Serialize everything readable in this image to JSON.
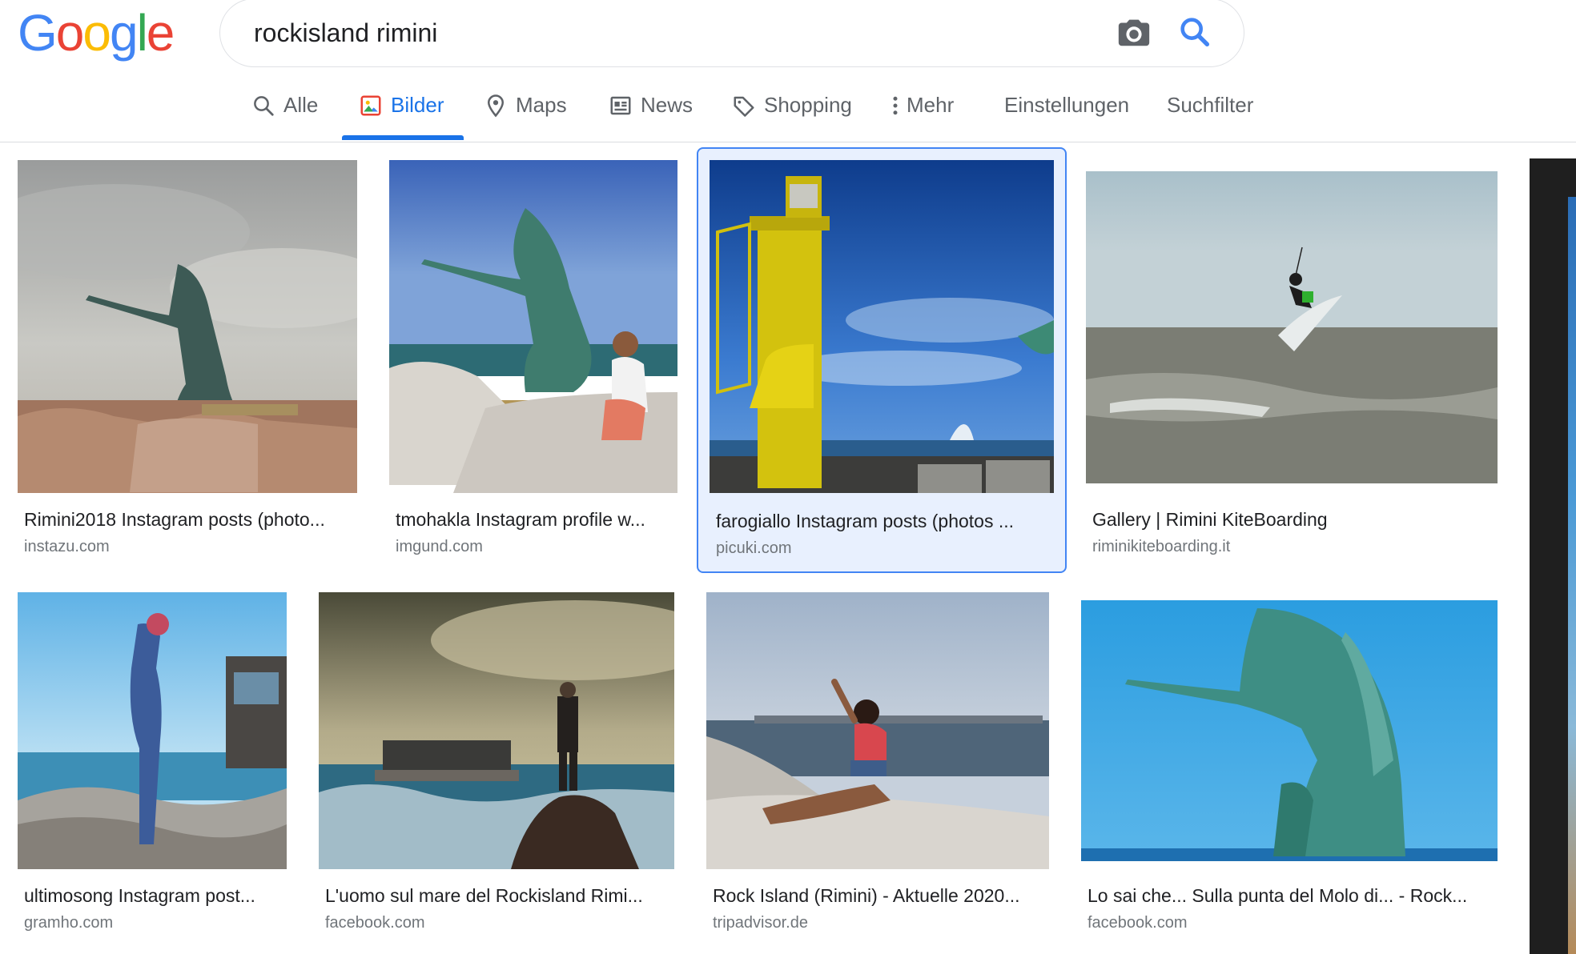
{
  "logo": {
    "letters": [
      "G",
      "o",
      "o",
      "g",
      "l",
      "e"
    ],
    "colors": [
      "#4285f4",
      "#ea4335",
      "#fbbc05",
      "#4285f4",
      "#34a853",
      "#ea4335"
    ]
  },
  "search": {
    "query": "rockisland rimini",
    "camera_icon": "camera-icon",
    "search_icon": "search-icon"
  },
  "tabs": [
    {
      "label": "Alle",
      "icon": "search-icon",
      "active": false
    },
    {
      "label": "Bilder",
      "icon": "image-icon",
      "active": true
    },
    {
      "label": "Maps",
      "icon": "map-pin-icon",
      "active": false
    },
    {
      "label": "News",
      "icon": "news-icon",
      "active": false
    },
    {
      "label": "Shopping",
      "icon": "tag-icon",
      "active": false
    },
    {
      "label": "Mehr",
      "icon": "more-vert-icon",
      "active": false
    },
    {
      "label": "Einstellungen",
      "icon": "",
      "active": false
    },
    {
      "label": "Suchfilter",
      "icon": "",
      "active": false
    }
  ],
  "accent_color": "#1a73e8",
  "results": [
    {
      "title": "Rimini2018 Instagram posts (photo...",
      "source": "instazu.com",
      "image": "statue-cloudy-sky",
      "selected": false
    },
    {
      "title": "tmohakla Instagram profile w...",
      "source": "imgund.com",
      "image": "statue-man-crouching",
      "selected": false
    },
    {
      "title": "farogiallo Instagram posts (photos ...",
      "source": "picuki.com",
      "image": "yellow-lighthouse",
      "selected": true
    },
    {
      "title": "Gallery | Rimini KiteBoarding",
      "source": "riminikiteboarding.it",
      "image": "kitesurfer-sea",
      "selected": false
    },
    {
      "title": "ultimosong Instagram post...",
      "source": "gramho.com",
      "image": "woman-on-rocks",
      "selected": false
    },
    {
      "title": "L'uomo sul mare del Rockisland Rimi...",
      "source": "facebook.com",
      "image": "man-on-rock-painting",
      "selected": false
    },
    {
      "title": "Rock Island (Rimini) - Aktuelle 2020...",
      "source": "tripadvisor.de",
      "image": "woman-sitting-rock",
      "selected": false
    },
    {
      "title": "Lo sai che... Sulla punta del Molo di... - Rock...",
      "source": "facebook.com",
      "image": "statue-blue-sky",
      "selected": false
    }
  ]
}
